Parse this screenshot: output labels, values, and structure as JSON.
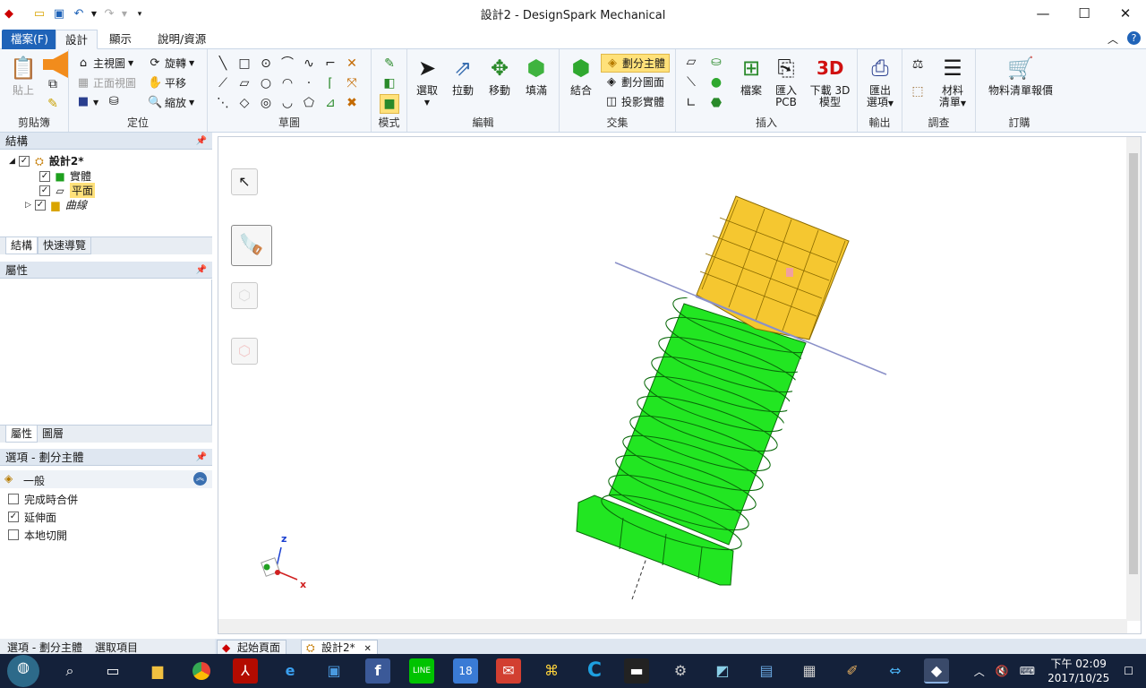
{
  "window": {
    "title": "設計2 - DesignSpark Mechanical",
    "minimize": "—",
    "maximize": "☐",
    "close": "✕"
  },
  "qat": [
    "app-icon",
    "open-icon",
    "save-icon",
    "undo-icon",
    "redo-icon",
    "customize-icon"
  ],
  "tabs": {
    "file": "檔案(F)",
    "design": "設計",
    "display": "顯示",
    "help": "說明/資源"
  },
  "ribbon": {
    "clipboard": {
      "label": "剪貼簿",
      "paste": "貼上"
    },
    "orient": {
      "label": "定位",
      "home": "主視圖",
      "front": "正面視圖",
      "rotate": "旋轉",
      "pan": "平移",
      "zoom": "縮放"
    },
    "sketch": {
      "label": "草圖"
    },
    "mode": {
      "label": "模式"
    },
    "edit": {
      "label": "編輯",
      "select": "選取",
      "pull": "拉動",
      "move": "移動",
      "fill": "填滿"
    },
    "intersect": {
      "label": "交集",
      "combine": "結合",
      "split_body": "劃分主體",
      "split_face": "劃分圖面",
      "project": "投影實體"
    },
    "insert": {
      "label": "插入",
      "file": "檔案",
      "import_pcb_1": "匯入",
      "import_pcb_2": "PCB",
      "download_1": "下載 3D",
      "download_2": "模型"
    },
    "output": {
      "label": "輸出",
      "export_1": "匯出",
      "export_2": "選項"
    },
    "investigate": {
      "label": "調查",
      "bom_1": "材料",
      "bom_2": "清單"
    },
    "order": {
      "label": "訂購",
      "quote": "物料清單報價"
    }
  },
  "structure": {
    "title": "結構",
    "root": "設計2*",
    "items": [
      "實體",
      "平面",
      "曲線"
    ],
    "tab_structure": "結構",
    "tab_quick": "快速導覽"
  },
  "properties": {
    "title": "屬性",
    "tab_props": "屬性",
    "tab_layers": "圖層"
  },
  "options": {
    "title": "選項 - 劃分主體",
    "section": "一般",
    "items": [
      {
        "label": "完成時合併",
        "checked": false
      },
      {
        "label": "延伸面",
        "checked": true
      },
      {
        "label": "本地切開",
        "checked": false
      }
    ]
  },
  "bottom_tabs": {
    "options": "選項 - 劃分主體",
    "selection": "選取項目"
  },
  "doc_tabs": {
    "start": "起始頁面",
    "design": "設計2*"
  },
  "axes": {
    "x": "x",
    "z": "z"
  },
  "clock": {
    "time": "下午 02:09",
    "date": "2017/10/25"
  },
  "colors": {
    "body_green": "#22e622",
    "split_yellow": "#f5c730",
    "accent": "#1f63b8",
    "taskbar": "#14213a"
  }
}
